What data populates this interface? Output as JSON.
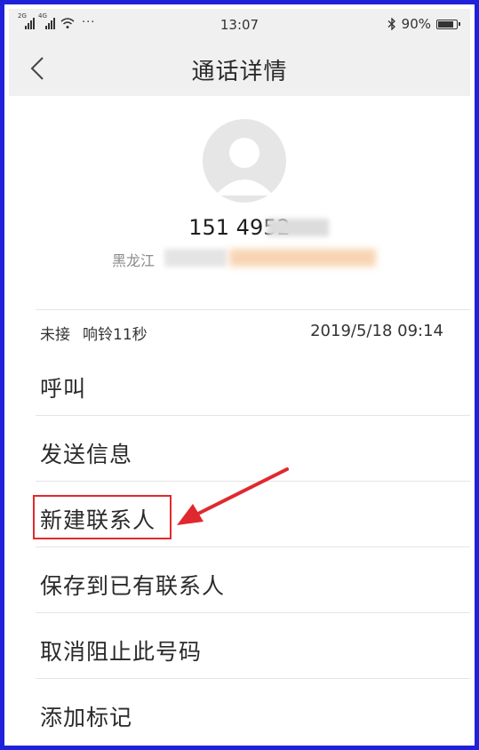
{
  "status_bar": {
    "signal1_tag": "2G",
    "signal2_tag": "4G",
    "overflow": "···",
    "time": "13:07",
    "battery_text": "90%",
    "battery_level": 0.9
  },
  "header": {
    "title": "通话详情"
  },
  "contact": {
    "phone_number": "151 4952",
    "location": "黑龙江"
  },
  "call": {
    "status": "未接",
    "ring_duration": "响铃11秒",
    "datetime": "2019/5/18 09:14"
  },
  "menu": {
    "items": [
      {
        "label": "呼叫"
      },
      {
        "label": "发送信息"
      },
      {
        "label": "新建联系人"
      },
      {
        "label": "保存到已有联系人"
      },
      {
        "label": "取消阻止此号码"
      },
      {
        "label": "添加标记"
      }
    ]
  },
  "colors": {
    "frame": "#1f22d8",
    "annotation": "#e0292f",
    "header_bg": "#f0f0f0"
  }
}
